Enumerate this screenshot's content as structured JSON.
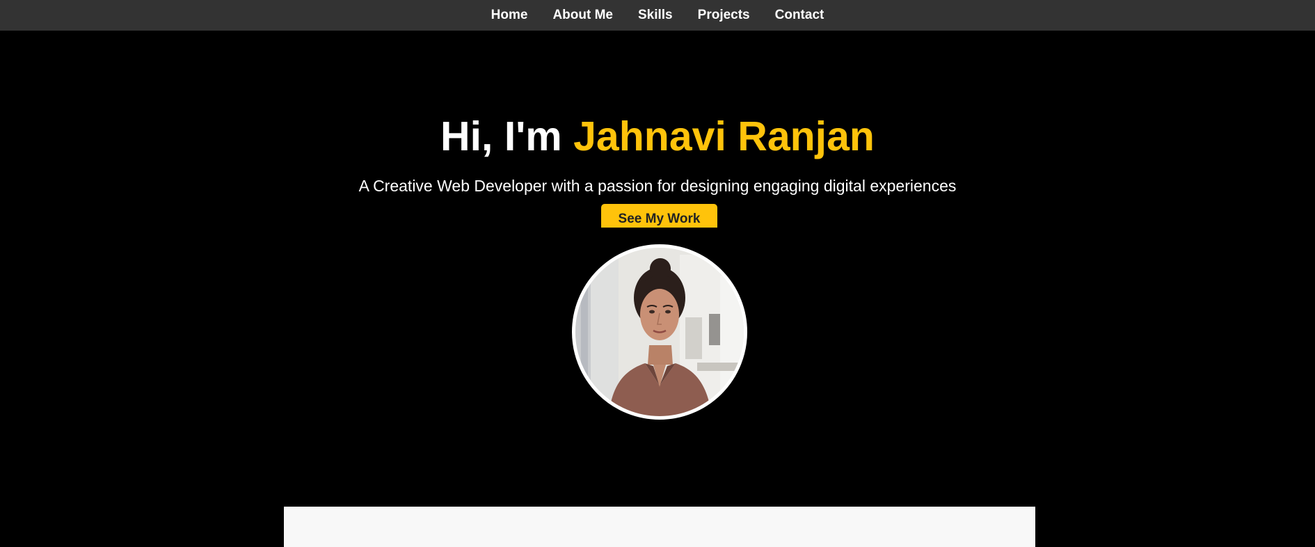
{
  "nav": {
    "items": [
      {
        "label": "Home"
      },
      {
        "label": "About Me"
      },
      {
        "label": "Skills"
      },
      {
        "label": "Projects"
      },
      {
        "label": "Contact"
      }
    ]
  },
  "hero": {
    "greeting": "Hi, I'm ",
    "name": "Jahnavi Ranjan",
    "subtitle": "A Creative Web Developer with a passion for designing engaging digital experiences",
    "cta_label": "See My Work"
  },
  "colors": {
    "background": "#000000",
    "navbar": "#333333",
    "accent": "#ffc30b",
    "text": "#ffffff",
    "section_panel": "#f8f8f8"
  },
  "icons": {
    "profile_photo": "profile-photo-woman-portrait"
  }
}
